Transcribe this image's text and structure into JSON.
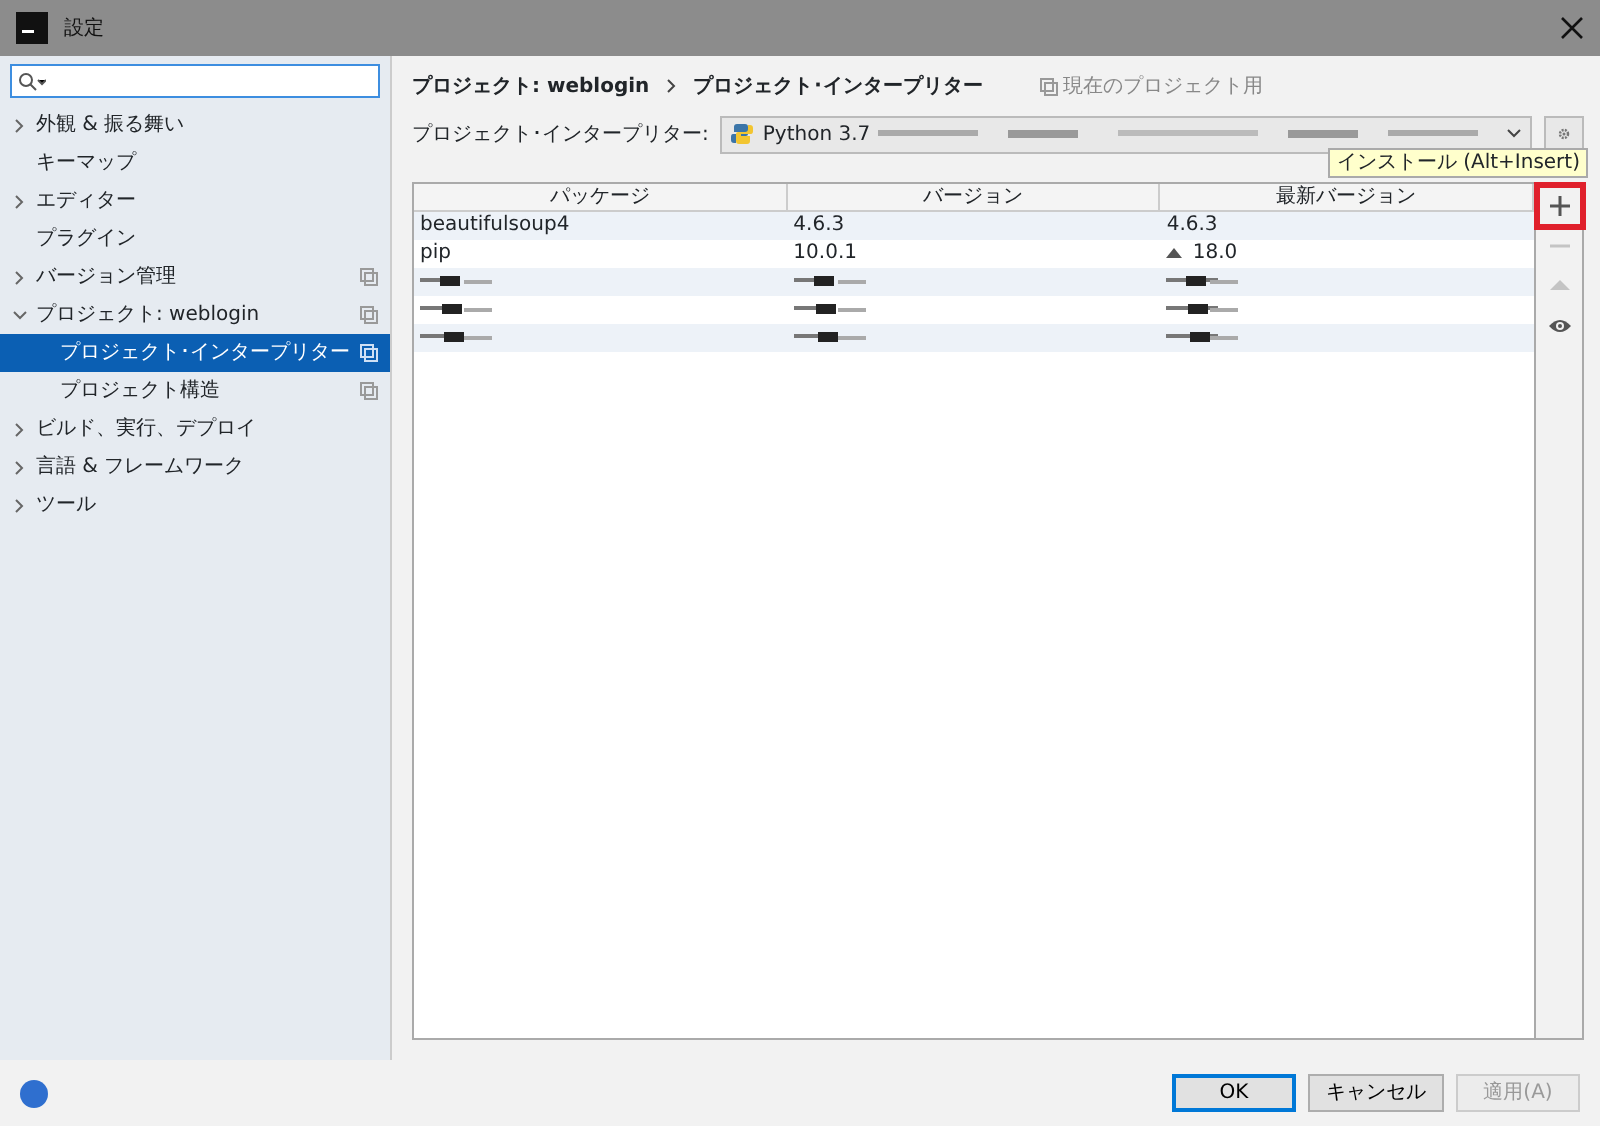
{
  "window": {
    "title": "設定"
  },
  "sidebar": {
    "items": [
      {
        "label": "外観 & 振る舞い",
        "expanded": false,
        "selected": false
      },
      {
        "label": "キーマップ",
        "selected": false
      },
      {
        "label": "エディター",
        "expanded": false,
        "selected": false
      },
      {
        "label": "プラグイン",
        "selected": false
      },
      {
        "label": "バージョン管理",
        "expanded": false,
        "project_scope": true,
        "selected": false
      },
      {
        "label": "プロジェクト: weblogin",
        "expanded": true,
        "project_scope": true,
        "selected": false,
        "children": [
          {
            "label": "プロジェクト･インタープリター",
            "project_scope": true,
            "selected": true
          },
          {
            "label": "プロジェクト構造",
            "project_scope": true,
            "selected": false
          }
        ]
      },
      {
        "label": "ビルド、実行、デプロイ",
        "expanded": false,
        "selected": false
      },
      {
        "label": "言語 & フレームワーク",
        "expanded": false,
        "selected": false
      },
      {
        "label": "ツール",
        "expanded": false,
        "selected": false
      }
    ]
  },
  "breadcrumb": [
    "プロジェクト: weblogin",
    "プロジェクト･インタープリター"
  ],
  "scope_note": "現在のプロジェクト用",
  "interpreter": {
    "label": "プロジェクト･インタープリター:",
    "value": "Python 3.7"
  },
  "table": {
    "columns": [
      "パッケージ",
      "バージョン",
      "最新バージョン"
    ],
    "rows": [
      {
        "kind": "package",
        "package": "beautifulsoup4",
        "version": "4.6.3",
        "latest": "4.6.3",
        "upgrade": false
      },
      {
        "kind": "package",
        "package": "pip",
        "version": "10.0.1",
        "latest": "18.0",
        "upgrade": true
      },
      {
        "kind": "redacted"
      },
      {
        "kind": "redacted"
      },
      {
        "kind": "redacted"
      }
    ]
  },
  "toolbar": [
    {
      "kind": "add",
      "disabled": false,
      "highlighted": true
    },
    {
      "kind": "remove",
      "disabled": true,
      "highlighted": false
    },
    {
      "kind": "upgrade",
      "disabled": true,
      "highlighted": false
    },
    {
      "kind": "show",
      "disabled": false,
      "highlighted": false
    }
  ],
  "tooltip": "インストール (Alt+Insert)",
  "buttons": [
    {
      "label": "OK",
      "disabled": false,
      "default": true
    },
    {
      "label": "キャンセル",
      "disabled": false,
      "default": false
    },
    {
      "label": "適用(A)",
      "disabled": true,
      "default": false
    }
  ]
}
